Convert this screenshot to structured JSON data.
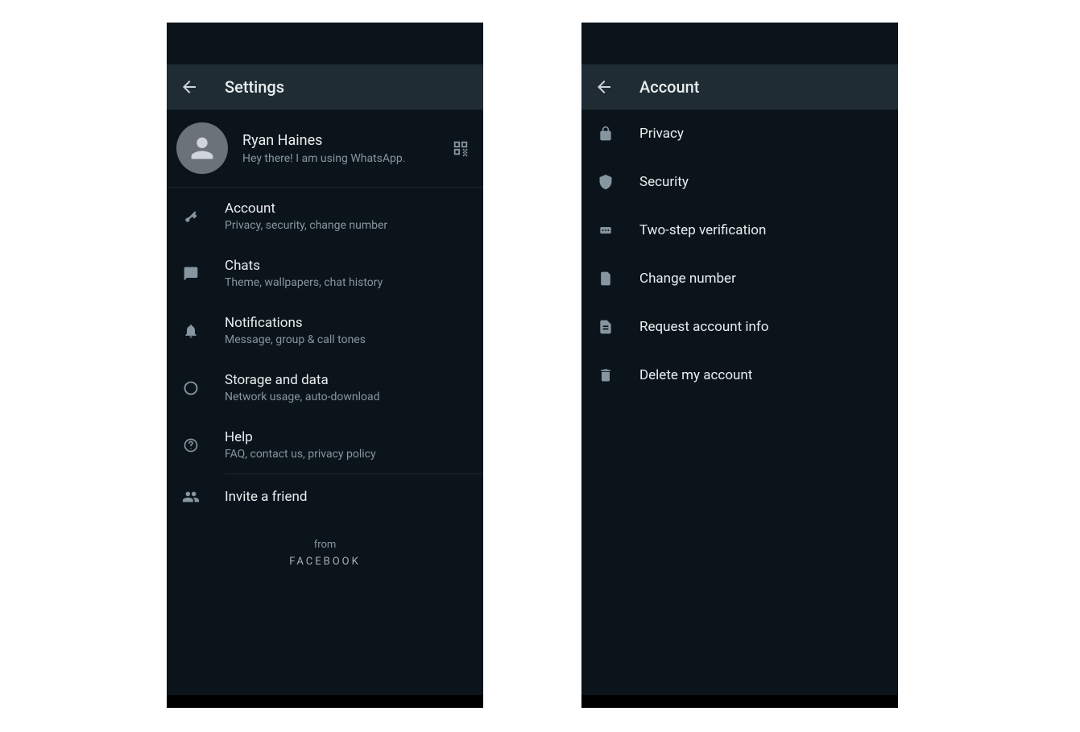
{
  "left": {
    "header_title": "Settings",
    "profile": {
      "name": "Ryan Haines",
      "status": "Hey there! I am using WhatsApp."
    },
    "items": [
      {
        "title": "Account",
        "sub": "Privacy, security, change number",
        "icon": "key"
      },
      {
        "title": "Chats",
        "sub": "Theme, wallpapers, chat history",
        "icon": "chat"
      },
      {
        "title": "Notifications",
        "sub": "Message, group & call tones",
        "icon": "bell"
      },
      {
        "title": "Storage and data",
        "sub": "Network usage, auto-download",
        "icon": "data"
      },
      {
        "title": "Help",
        "sub": "FAQ, contact us, privacy policy",
        "icon": "help"
      }
    ],
    "invite": {
      "title": "Invite a friend"
    },
    "footer_from": "from",
    "footer_brand": "FACEBOOK"
  },
  "right": {
    "header_title": "Account",
    "items": [
      {
        "title": "Privacy",
        "icon": "lock"
      },
      {
        "title": "Security",
        "icon": "shield"
      },
      {
        "title": "Two-step verification",
        "icon": "pin"
      },
      {
        "title": "Change number",
        "icon": "sim"
      },
      {
        "title": "Request account info",
        "icon": "doc"
      },
      {
        "title": "Delete my account",
        "icon": "trash"
      }
    ]
  }
}
